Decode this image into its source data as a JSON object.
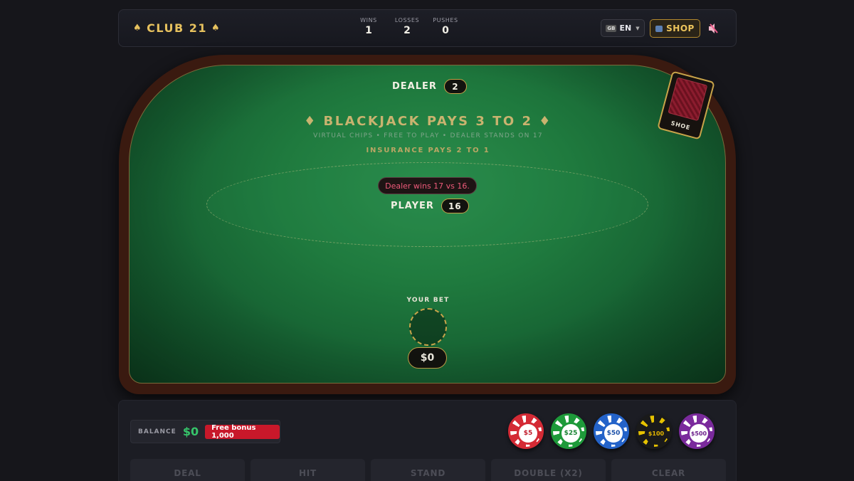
{
  "header": {
    "logo": "CLUB 21",
    "stats": [
      {
        "label": "WINS",
        "value": "1"
      },
      {
        "label": "LOSSES",
        "value": "2"
      },
      {
        "label": "PUSHES",
        "value": "0"
      }
    ],
    "language": {
      "flag": "GB",
      "label": "EN"
    },
    "shop_label": "SHOP"
  },
  "table": {
    "dealer_label": "DEALER",
    "dealer_score": "2",
    "pays_title": "♦ BLACKJACK PAYS 3 TO 2 ♦",
    "subtitle": "VIRTUAL CHIPS • FREE TO PLAY • DEALER STANDS ON 17",
    "insurance": "INSURANCE PAYS 2 TO 1",
    "result_message": "Dealer wins 17 vs 16.",
    "player_label": "PLAYER",
    "player_score": "16",
    "your_bet_label": "YOUR BET",
    "bet_amount": "$0",
    "shoe_label": "SHOE"
  },
  "controls": {
    "balance_label": "BALANCE",
    "balance_value": "$0",
    "bonus_label": "Free bonus 1,000",
    "chips": [
      {
        "label": "$5",
        "color": "#d42a35",
        "text_color": "#c01a2a"
      },
      {
        "label": "$25",
        "color": "#1e9a3a",
        "text_color": "#188432"
      },
      {
        "label": "$50",
        "color": "#2463c9",
        "text_color": "#1a4fa8"
      },
      {
        "label": "$100",
        "color": "#1a1a1a",
        "text_color": "#e6b800"
      },
      {
        "label": "$500",
        "color": "#7a2a9c",
        "text_color": "#6b1f8a"
      }
    ],
    "actions": [
      "DEAL",
      "HIT",
      "STAND",
      "DOUBLE (X2)",
      "CLEAR"
    ]
  }
}
